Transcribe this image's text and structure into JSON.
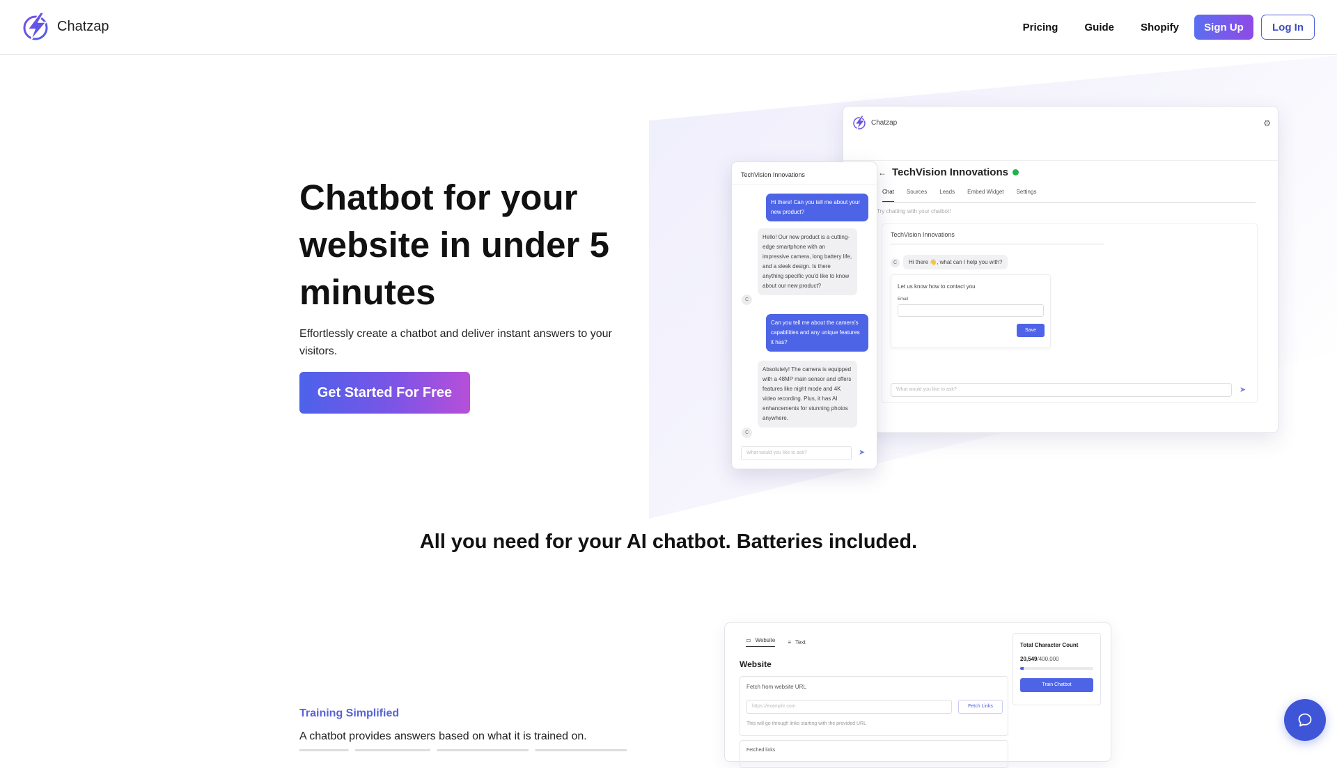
{
  "nav": {
    "brand": "Chatzap",
    "links": [
      "Pricing",
      "Guide",
      "Shopify"
    ],
    "signup": "Sign Up",
    "login": "Log In"
  },
  "hero": {
    "title": "Chatbot for your website in under 5 minutes",
    "subtitle": "Effortlessly create a chatbot and deliver instant answers to your visitors.",
    "cta": "Get Started For Free"
  },
  "dashboard": {
    "brand": "Chatzap",
    "bot_name": "TechVision Innovations",
    "tabs": [
      "Chat",
      "Sources",
      "Leads",
      "Embed Widget",
      "Settings"
    ],
    "hint": "Try chatting with your chatbot!",
    "chat_title": "TechVision Innovations",
    "avatar": "C",
    "greeting": "Hi there 👋, what can I help you with?",
    "form_title": "Let us know how to contact you",
    "form_label": "Email",
    "form_button": "Save",
    "ask_placeholder": "What would you like to ask?"
  },
  "widget": {
    "title": "TechVision Innovations",
    "messages": [
      {
        "role": "user",
        "text": "Hi there! Can you tell me about your new product?"
      },
      {
        "role": "bot",
        "text": "Hello! Our new product is a cutting-edge smartphone with an impressive camera, long battery life, and a sleek design. Is there anything specific you'd like to know about our new product?"
      },
      {
        "role": "user",
        "text": "Can you tell me about the camera's capabilities and any unique features it has?"
      },
      {
        "role": "bot",
        "text": "Absolutely! The camera is equipped with a 48MP main sensor and offers features like night mode and 4K video recording. Plus, it has AI enhancements for stunning photos anywhere."
      }
    ],
    "avatar": "C",
    "ask_placeholder": "What would you like to ask?"
  },
  "features": {
    "title": "All you need for your AI chatbot. Batteries included.",
    "training_label": "Training Simplified",
    "training_text": "A chatbot provides answers based on what it is trained on."
  },
  "training_card": {
    "tabs": [
      "Website",
      "Text"
    ],
    "heading": "Website",
    "fetch_label": "Fetch from website URL",
    "url_placeholder": "https://example.com",
    "fetch_button": "Fetch Links",
    "note": "This will go through links starting with the provided URL",
    "fetched_label": "Fetched links",
    "count_title": "Total Character Count",
    "count_used": "20,549",
    "count_total": "/400,000",
    "count_fraction": 0.051,
    "train_button": "Train Chatbot"
  },
  "colors": {
    "accent": "#4e64e6",
    "gradient_start": "#4c62ea",
    "gradient_end": "#b74fd9",
    "label_accent": "#5863d6"
  },
  "icons": {
    "logo": "lightning-bolt-logo-icon",
    "settings": "gear-icon",
    "send": "send-arrow-icon",
    "back": "back-arrow-icon",
    "verified": "status-dot-icon",
    "fab": "chat-bubble-icon"
  }
}
